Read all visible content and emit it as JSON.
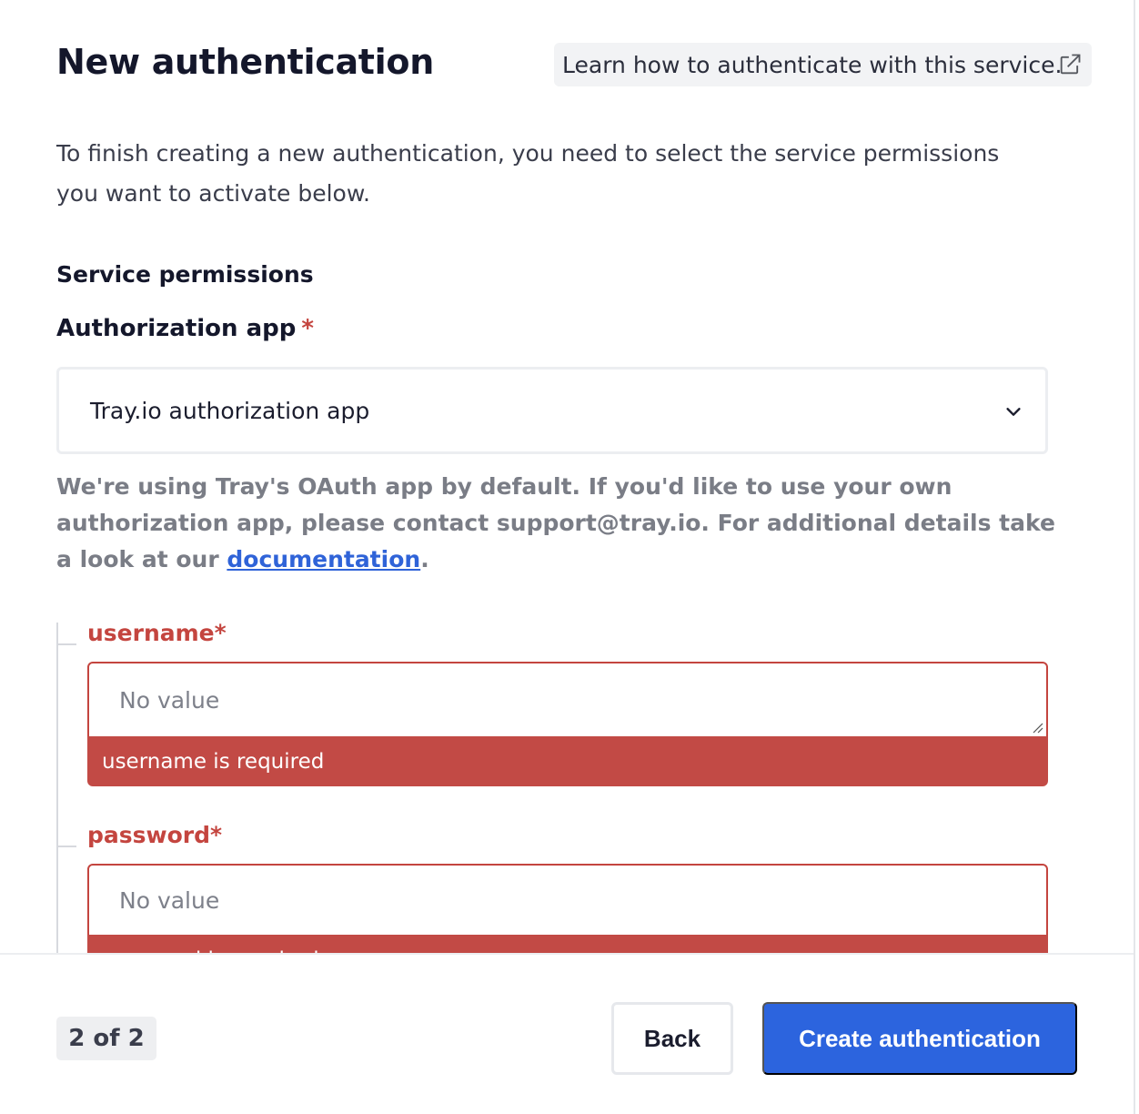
{
  "dialog": {
    "title": "New authentication",
    "learn_link": "Learn how to authenticate with this service.",
    "intro": "To finish creating a new authentication, you need to select the service permissions you want to activate below."
  },
  "permissions": {
    "section_title": "Service permissions",
    "auth_app_label": "Authorization app",
    "required_mark": "*",
    "auth_app_value": "Tray.io authorization app",
    "help_text": "We're using Tray's OAuth app by default. If you'd like to use your own authorization app, please contact support@tray.io. For additional details take a look at our",
    "help_link": "documentation",
    "help_end": "."
  },
  "fields": [
    {
      "label": "username*",
      "placeholder": "No value",
      "error": "username is required"
    },
    {
      "label": "password*",
      "placeholder": "No value",
      "error": "password is required"
    }
  ],
  "footer": {
    "step": "2 of 2",
    "back_label": "Back",
    "create_label": "Create authentication"
  },
  "colors": {
    "accent": "#2c64de",
    "error": "#c4453f"
  },
  "icons": {
    "external_link": "external-link-icon",
    "dropdown": "chevron-down-icon"
  }
}
